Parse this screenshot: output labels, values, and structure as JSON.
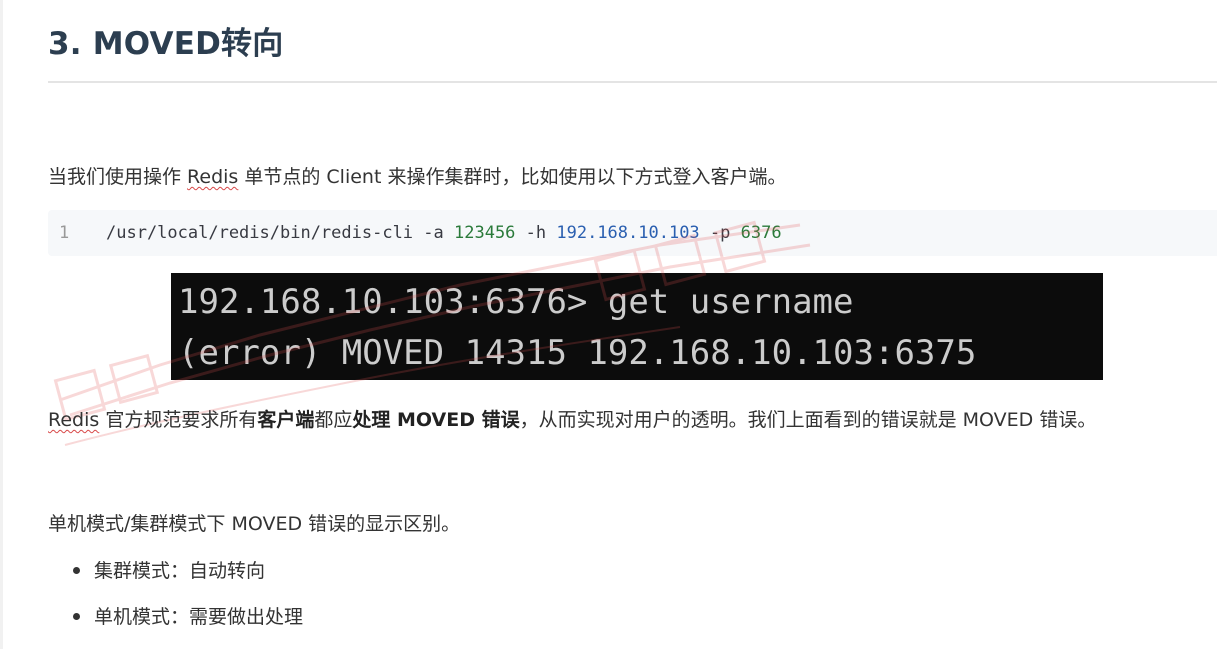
{
  "heading": "3. MOVED转向",
  "intro": {
    "before": "当我们使用操作 ",
    "redis": "Redis",
    "after": " 单节点的 Client 来操作集群时，比如使用以下方式登入客户端。"
  },
  "code_block": {
    "line_number": "1",
    "command": "/usr/local/redis/bin/redis-cli -a ",
    "password": "123456",
    "host_flag": " -h ",
    "host": "192.168.10.103",
    "port_flag": " -p ",
    "port": "6376"
  },
  "terminal": {
    "line1": "192.168.10.103:6376> get username",
    "line2": "(error) MOVED 14315 192.168.10.103:6375"
  },
  "spec_paragraph": {
    "redis": "Redis",
    "part1": " 官方规范要求所有",
    "bold1": "客户端",
    "part2": "都应",
    "bold2": "处理 MOVED 错误",
    "part3": "，从而实现对用户的透明。我们上面看到的错误就是 MOVED 错误。"
  },
  "modes_intro": "单机模式/集群模式下 MOVED 错误的显示区别。",
  "bullets": [
    "集群模式：自动转向",
    "单机模式：需要做出处理"
  ],
  "watermark_color": "#e05050"
}
